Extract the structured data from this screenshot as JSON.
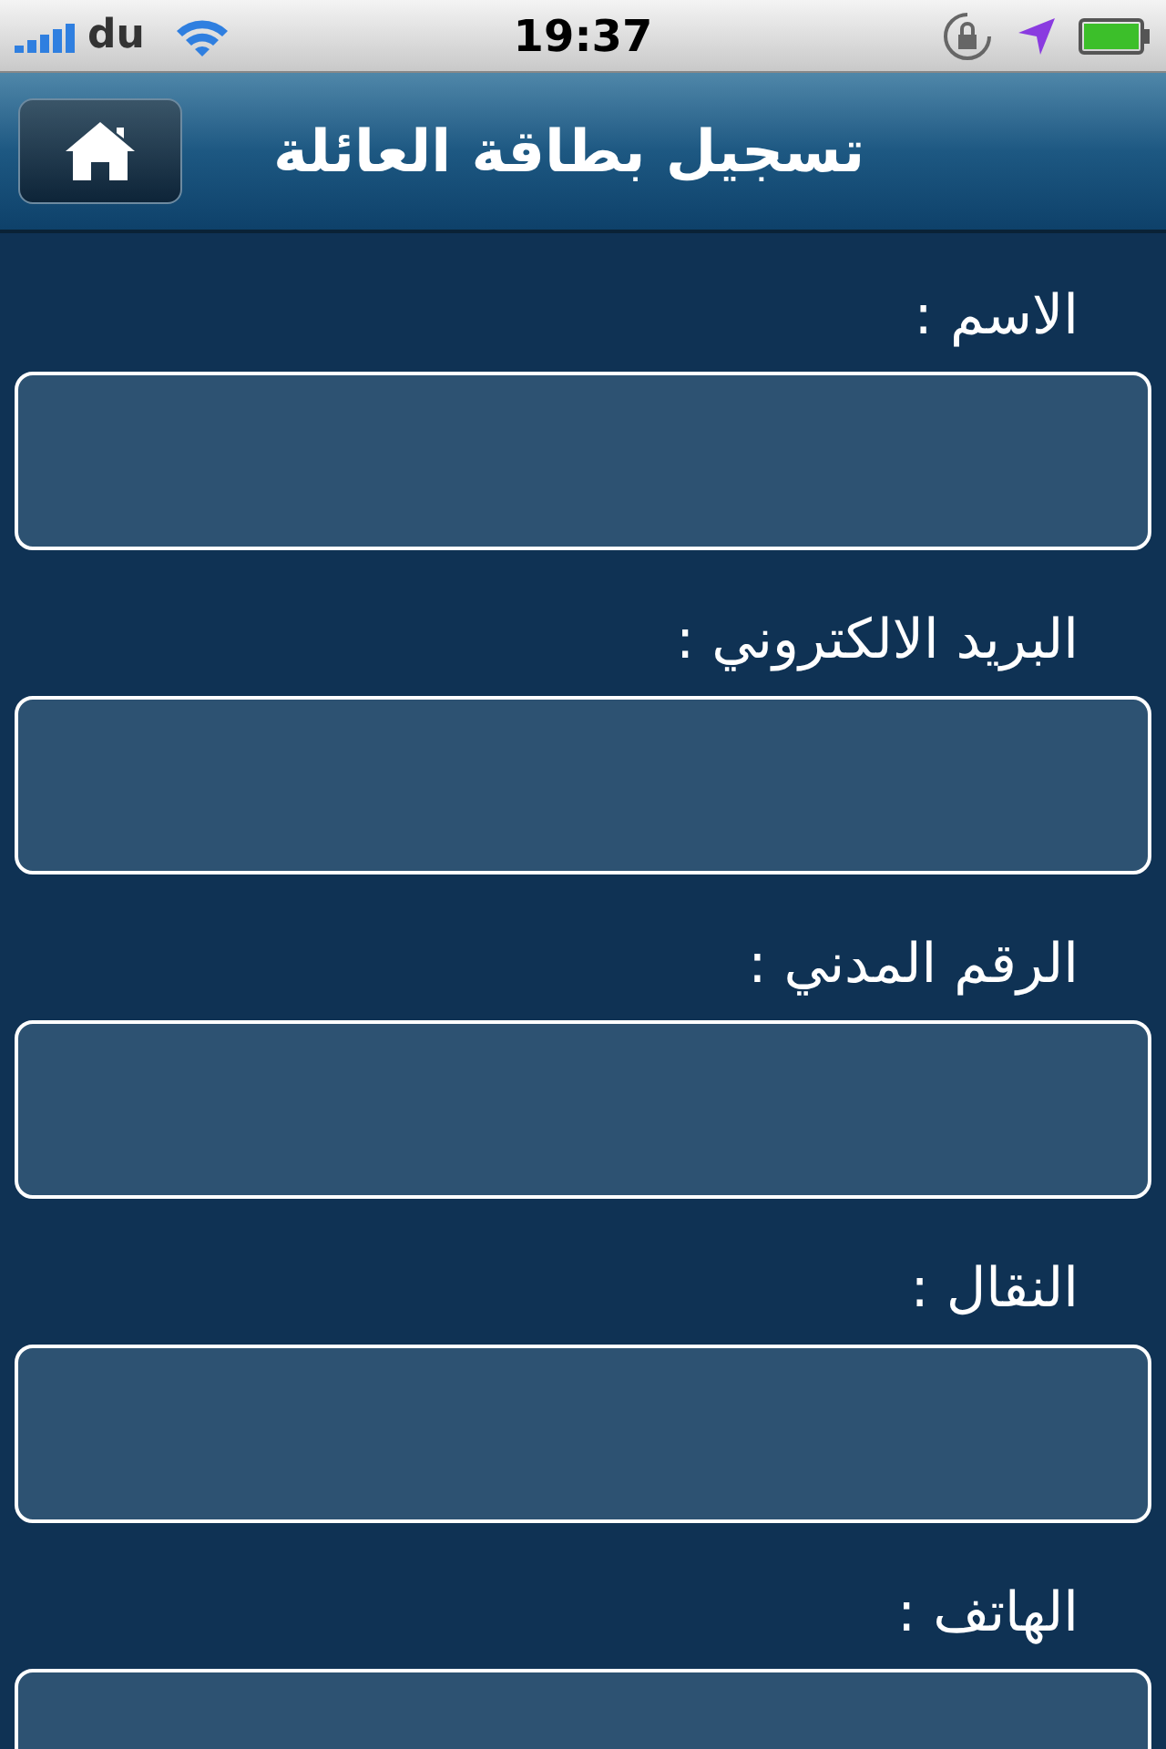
{
  "status_bar": {
    "carrier": "du",
    "time": "19:37"
  },
  "nav_bar": {
    "title": "تسجيل بطاقة العائلة"
  },
  "fields": [
    {
      "label": "الاسم :"
    },
    {
      "label": "البريد الالكتروني :"
    },
    {
      "label": "الرقم المدني :"
    },
    {
      "label": "النقال :"
    },
    {
      "label": "الهاتف :"
    }
  ]
}
